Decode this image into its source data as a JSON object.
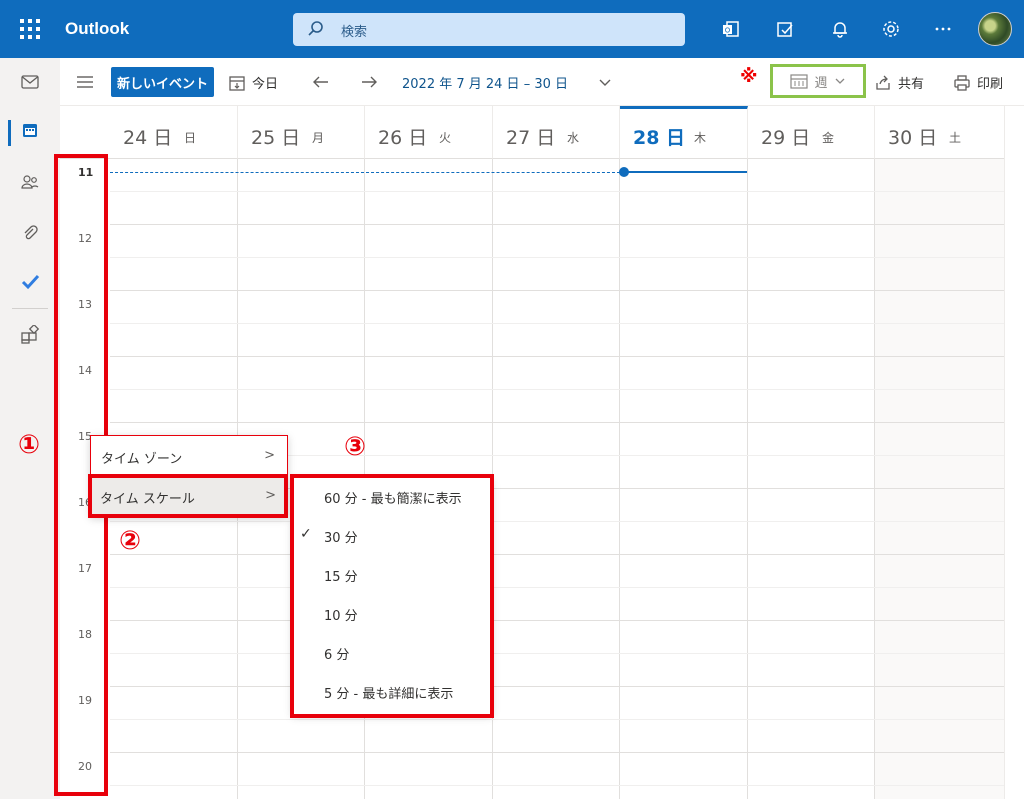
{
  "app": {
    "name": "Outlook"
  },
  "search": {
    "placeholder": "検索"
  },
  "toolbar": {
    "new_event": "新しいイベント",
    "today": "今日",
    "date_range": "2022 年 7 月 24 日 – 30 日",
    "view": "週",
    "share": "共有",
    "print": "印刷",
    "note_mark": "※"
  },
  "days": [
    {
      "num": "24 日",
      "dow": "日"
    },
    {
      "num": "25 日",
      "dow": "月"
    },
    {
      "num": "26 日",
      "dow": "火"
    },
    {
      "num": "27 日",
      "dow": "水"
    },
    {
      "num": "28 日",
      "dow": "木",
      "today": true
    },
    {
      "num": "29 日",
      "dow": "金"
    },
    {
      "num": "30 日",
      "dow": "土"
    }
  ],
  "hours": [
    "11",
    "12",
    "13",
    "14",
    "15",
    "16",
    "17",
    "18",
    "19",
    "20"
  ],
  "context_menu": {
    "items": [
      "タイム ゾーン",
      "タイム スケール"
    ]
  },
  "scale_menu": {
    "items": [
      {
        "label": "60 分 - 最も簡潔に表示",
        "checked": false
      },
      {
        "label": "30 分",
        "checked": true
      },
      {
        "label": "15 分",
        "checked": false
      },
      {
        "label": "10 分",
        "checked": false
      },
      {
        "label": "6 分",
        "checked": false
      },
      {
        "label": "5 分 - 最も詳細に表示",
        "checked": false
      }
    ]
  },
  "annotations": {
    "one": "①",
    "two": "②",
    "three": "③"
  },
  "colors": {
    "brand": "#0f6cbd",
    "annotation": "#e8000b",
    "highlight": "#8bc34a"
  },
  "icons": [
    "waffle-icon",
    "search-icon",
    "office-icon",
    "todo-icon",
    "bell-icon",
    "gear-icon",
    "more-icon",
    "mail-icon",
    "calendar-icon",
    "people-icon",
    "attach-icon",
    "check-icon",
    "apps-icon"
  ]
}
